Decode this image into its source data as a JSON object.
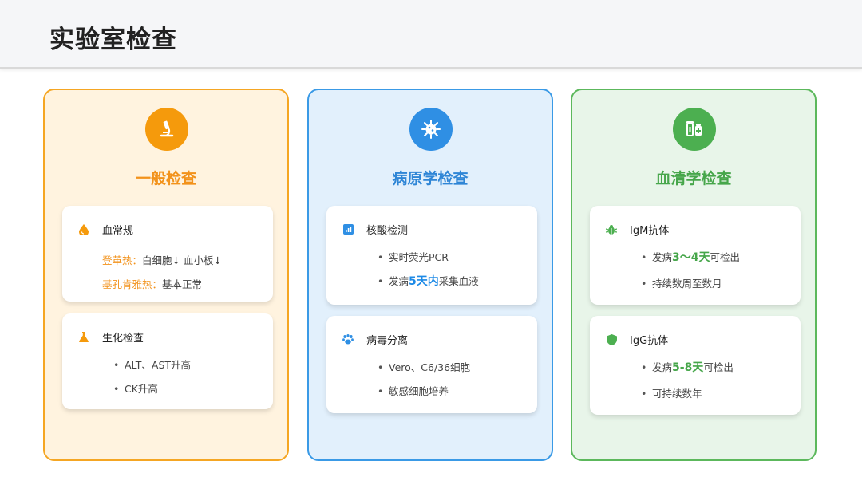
{
  "header": {
    "title": "实验室检查"
  },
  "colors": {
    "orange": "#f59a0c",
    "blue": "#2f8fe4",
    "green": "#4caf50"
  },
  "columns": [
    {
      "title": "一般检查",
      "icon": "microscope-icon",
      "cards": [
        {
          "icon": "drop-icon",
          "label": "血常规",
          "lines": [
            {
              "prefix": "登革热：",
              "text": "白细胞↓ 血小板↓"
            },
            {
              "prefix": "基孔肯雅热：",
              "text": "基本正常"
            }
          ]
        },
        {
          "icon": "flask-icon",
          "label": "生化检查",
          "lines": [
            {
              "text": "ALT、AST升高"
            },
            {
              "text": "CK升高"
            }
          ]
        }
      ]
    },
    {
      "title": "病原学检查",
      "icon": "virus-icon",
      "cards": [
        {
          "icon": "chart-icon",
          "label": "核酸检测",
          "lines": [
            {
              "text": "实时荧光PCR"
            },
            {
              "pre": "发病",
              "highlight": "5天内",
              "post": "采集血液"
            }
          ]
        },
        {
          "icon": "paw-icon",
          "label": "病毒分离",
          "lines": [
            {
              "text": "Vero、C6/36细胞"
            },
            {
              "text": "敏感细胞培养"
            }
          ]
        }
      ]
    },
    {
      "title": "血清学检查",
      "icon": "vials-icon",
      "cards": [
        {
          "icon": "bug-icon",
          "label": "IgM抗体",
          "lines": [
            {
              "pre": "发病",
              "highlight": "3～4天",
              "post": "可检出"
            },
            {
              "text": "持续数周至数月"
            }
          ]
        },
        {
          "icon": "shield-icon",
          "label": "IgG抗体",
          "lines": [
            {
              "pre": "发病",
              "highlight": "5-8天",
              "post": "可检出"
            },
            {
              "text": "可持续数年"
            }
          ]
        }
      ]
    }
  ]
}
